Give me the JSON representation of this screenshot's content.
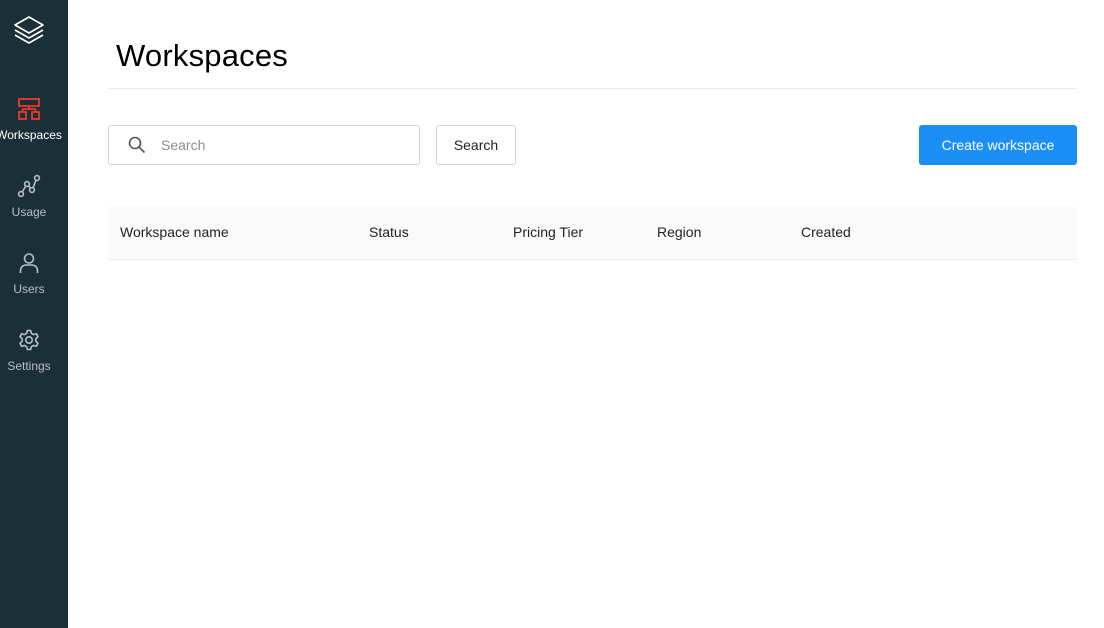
{
  "sidebar": {
    "logo_icon": "stacked-layers-icon",
    "active_color": "#ec3a2b",
    "items": [
      {
        "label": "Workspaces",
        "icon": "workspaces-hierarchy-icon",
        "active": true
      },
      {
        "label": "Usage",
        "icon": "usage-graph-icon",
        "active": false
      },
      {
        "label": "Users",
        "icon": "user-icon",
        "active": false
      },
      {
        "label": "Settings",
        "icon": "gear-icon",
        "active": false
      }
    ]
  },
  "main": {
    "title": "Workspaces",
    "search": {
      "placeholder": "Search",
      "value": "",
      "button_label": "Search"
    },
    "create_button_label": "Create workspace",
    "accent_color": "#1b8ff5",
    "table": {
      "columns": [
        "Workspace name",
        "Status",
        "Pricing Tier",
        "Region",
        "Created"
      ],
      "rows": []
    }
  }
}
